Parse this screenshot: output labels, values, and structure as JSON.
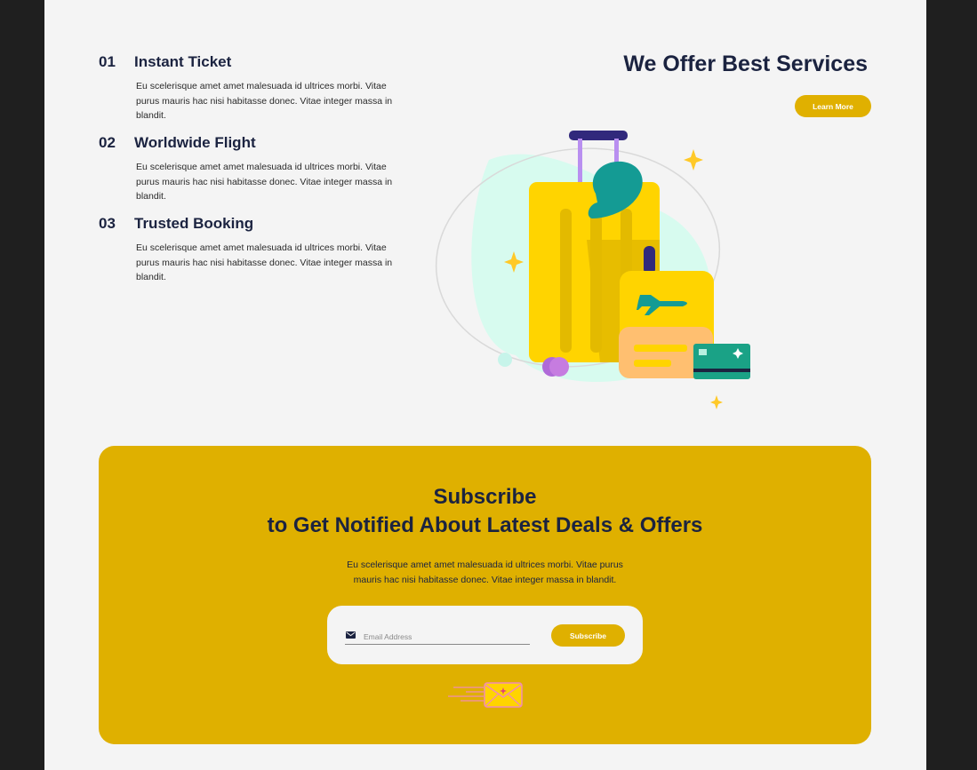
{
  "services": [
    {
      "num": "01",
      "title": "Instant Ticket",
      "desc": "Eu scelerisque amet amet malesuada id ultrices morbi. Vitae purus mauris hac nisi habitasse donec. Vitae integer massa in blandit."
    },
    {
      "num": "02",
      "title": "Worldwide Flight",
      "desc": "Eu scelerisque amet amet malesuada id ultrices morbi. Vitae purus mauris hac nisi habitasse donec. Vitae integer massa in blandit."
    },
    {
      "num": "03",
      "title": "Trusted Booking",
      "desc": "Eu scelerisque amet amet malesuada id ultrices morbi. Vitae purus mauris hac nisi habitasse donec. Vitae integer massa in blandit."
    }
  ],
  "offer": {
    "heading": "We Offer Best Services",
    "button": "Learn More"
  },
  "subscribe": {
    "title_line1": "Subscribe",
    "title_line2": "to Get Notified About Latest Deals & Offers",
    "desc_line1": "Eu scelerisque amet amet malesuada id ultrices morbi. Vitae purus",
    "desc_line2": "mauris hac nisi habitasse donec. Vitae integer massa in blandit.",
    "email_placeholder": "Email Address",
    "email_value": "",
    "button": "Subscribe",
    "email_icon": "envelope-icon"
  },
  "colors": {
    "accent": "#dfb000",
    "heading": "#1b2340",
    "page_bg": "#f4f4f4",
    "frame_bg": "#1f1f1f"
  }
}
